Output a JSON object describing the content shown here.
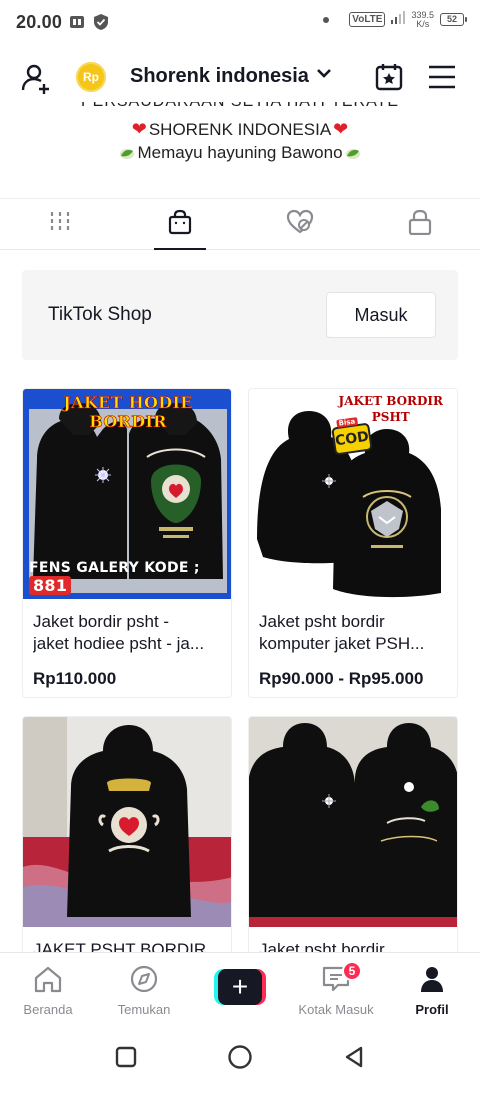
{
  "status_bar": {
    "time": "20.00",
    "network": "VoLTE",
    "speed_value": "339.5",
    "speed_unit": "K/s",
    "battery": "52",
    "icons": [
      "sim-card-icon",
      "shield-check-icon",
      "notification-dot",
      "signal-icon",
      "battery-icon"
    ]
  },
  "header": {
    "profile_name": "Shorenk indonesia",
    "coin_label": "Rp",
    "icons": [
      "add-user-icon",
      "coin-icon",
      "chevron-down-icon",
      "calendar-icon",
      "menu-icon"
    ]
  },
  "bio": {
    "line_cut": "PERSAUDARAAN SETIA HATI TERATE",
    "line1": "SHORENK INDONESIA",
    "line2": "Memayu hayuning Bawono"
  },
  "tabs": [
    {
      "name": "videos",
      "icon": "grid-icon",
      "active": false
    },
    {
      "name": "shop",
      "icon": "shopping-bag-icon",
      "active": true
    },
    {
      "name": "liked",
      "icon": "heart-hidden-icon",
      "active": false
    },
    {
      "name": "private",
      "icon": "lock-icon",
      "active": false
    }
  ],
  "shop_banner": {
    "title": "TikTok Shop",
    "login_label": "Masuk"
  },
  "products": [
    {
      "title_line1": "Jaket bordir psht -",
      "title_line2": "jaket hodiee psht - ja...",
      "price": "Rp110.000",
      "image_top_text": "JAKET HODIE BORDIR",
      "image_bottom_text": "FENS GALERY  KODE ;",
      "image_code": "881"
    },
    {
      "title_line1": "Jaket psht bordir",
      "title_line2": "komputer jaket PSH...",
      "price": "Rp90.000 - Rp95.000",
      "image_text_line1": "JAKET BORDIR",
      "image_text_line2": "PSHT",
      "image_badge": "COD",
      "image_badge_small": "Bisa"
    },
    {
      "title_line1": "JAKET PSHT BORDIR",
      "title_line2": "",
      "price": ""
    },
    {
      "title_line1": "Jaket psht bordir",
      "title_line2": "",
      "price": ""
    }
  ],
  "bottom_nav": {
    "items": [
      {
        "label": "Beranda",
        "icon": "home-icon"
      },
      {
        "label": "Temukan",
        "icon": "compass-icon"
      },
      {
        "label": "",
        "icon": "plus-icon"
      },
      {
        "label": "Kotak Masuk",
        "icon": "inbox-icon",
        "badge": "5"
      },
      {
        "label": "Profil",
        "icon": "profile-icon",
        "active": true
      }
    ]
  },
  "system_nav": [
    "recents-square-icon",
    "home-circle-icon",
    "back-triangle-icon"
  ],
  "colors": {
    "accent_red": "#fe2c55",
    "accent_cyan": "#25f4ee",
    "text_primary": "#161823",
    "text_secondary": "#8a8b91"
  }
}
